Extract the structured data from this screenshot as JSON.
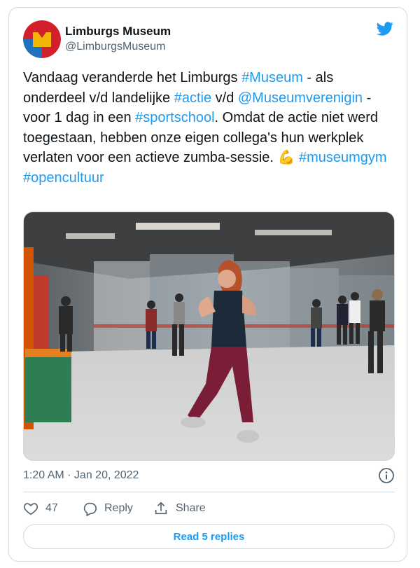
{
  "author": {
    "name": "Limburgs Museum",
    "handle": "@LimburgsMuseum"
  },
  "tweet": {
    "segments": [
      {
        "text": "Vandaag veranderde het Limburgs ",
        "link": false
      },
      {
        "text": "#Museum",
        "link": true
      },
      {
        "text": " - als onderdeel v/d landelijke ",
        "link": false
      },
      {
        "text": "#actie",
        "link": true
      },
      {
        "text": " v/d ",
        "link": false
      },
      {
        "text": "@Museumverenigin",
        "link": true
      },
      {
        "text": " - voor 1 dag in een ",
        "link": false
      },
      {
        "text": "#sportschool",
        "link": true
      },
      {
        "text": ". Omdat de actie niet werd toegestaan, hebben onze eigen collega's hun werkplek verlaten voor een actieve zumba-sessie. ",
        "link": false
      },
      {
        "text": "💪",
        "link": false
      },
      {
        "text": " ",
        "link": false
      },
      {
        "text": "#museumgym",
        "link": true
      },
      {
        "text": " ",
        "link": false
      },
      {
        "text": "#opencultuur",
        "link": true
      }
    ],
    "timestamp": "1:20 AM · Jan 20, 2022"
  },
  "actions": {
    "likes": "47",
    "reply_label": "Reply",
    "share_label": "Share"
  },
  "read_replies_label": "Read 5 replies",
  "colors": {
    "accent": "#1d9bf0",
    "text": "#0f1419",
    "secondary": "#536471",
    "border": "#cfd9de"
  },
  "icons": [
    "avatar-logo",
    "twitter-bird-icon",
    "info-icon",
    "heart-icon",
    "reply-icon",
    "share-icon"
  ]
}
